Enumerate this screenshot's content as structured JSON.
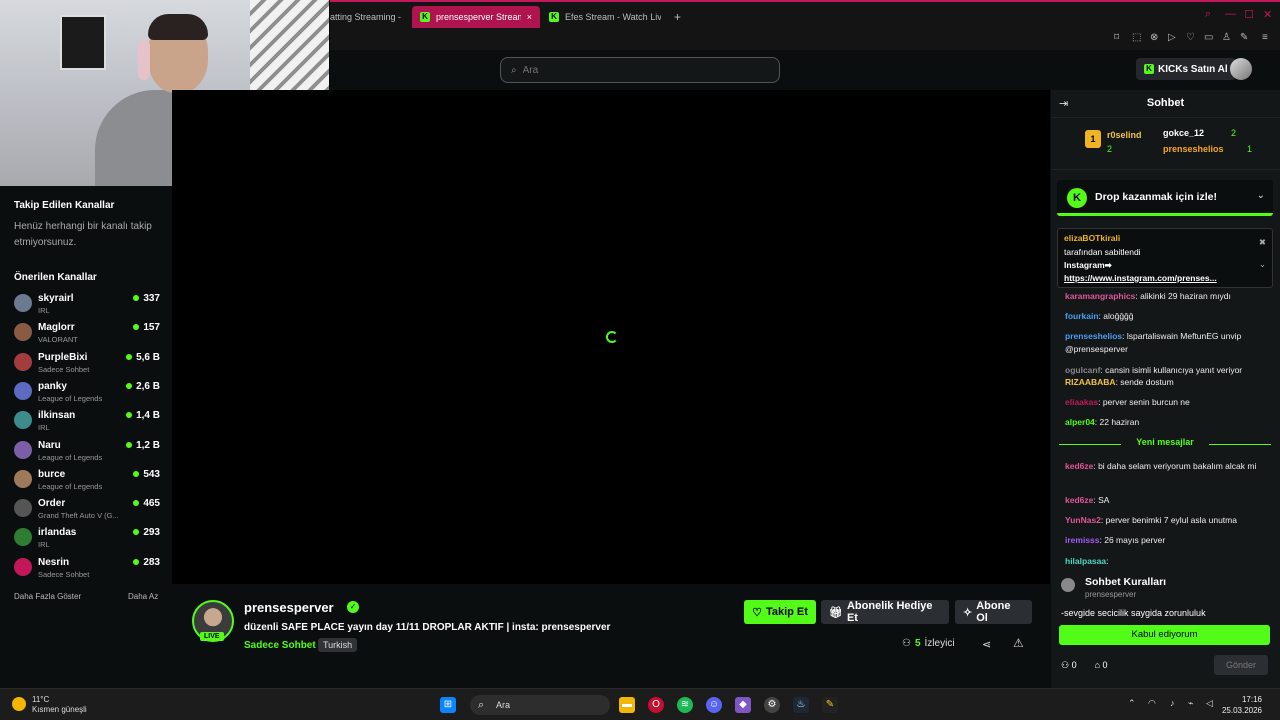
{
  "browser": {
    "tabs": [
      {
        "label": "atting Streaming -",
        "active": false
      },
      {
        "label": "prensesperver Stream",
        "active": true
      },
      {
        "label": "Efes Stream - Watch Live",
        "active": false
      }
    ],
    "new_tab": "+",
    "close": "×"
  },
  "header": {
    "search_placeholder": "Ara",
    "kicks_label": "KICKs Satın Al"
  },
  "sidebar": {
    "followed_title": "Takip Edilen Kanallar",
    "followed_empty": "Henüz herhangi bir kanalı takip etmiyorsunuz.",
    "recommended_title": "Önerilen Kanallar",
    "channels": [
      {
        "name": "skyrairl",
        "category": "IRL",
        "viewers": "337",
        "color": "#6b7a8f"
      },
      {
        "name": "Maglorr",
        "category": "VALORANT",
        "viewers": "157",
        "color": "#8a5a44"
      },
      {
        "name": "PurpleBixi",
        "category": "Sadece Sohbet",
        "viewers": "5,6 B",
        "color": "#a33d3d"
      },
      {
        "name": "panky",
        "category": "League of Legends",
        "viewers": "2,6 B",
        "color": "#5c6bc0"
      },
      {
        "name": "ilkinsan",
        "category": "IRL",
        "viewers": "1,4 B",
        "color": "#3d8b8b"
      },
      {
        "name": "Naru",
        "category": "League of Legends",
        "viewers": "1,2 B",
        "color": "#7b5ea7"
      },
      {
        "name": "burce",
        "category": "League of Legends",
        "viewers": "543",
        "color": "#9e7a5a"
      },
      {
        "name": "Order",
        "category": "Grand Theft Auto V (G...",
        "viewers": "465",
        "color": "#555555"
      },
      {
        "name": "irlandas",
        "category": "IRL",
        "viewers": "293",
        "color": "#2e7d32"
      },
      {
        "name": "Nesrin",
        "category": "Sadece Sohbet",
        "viewers": "283",
        "color": "#c2185b"
      }
    ],
    "show_more": "Daha Fazla Göster",
    "show_less": "Daha Az"
  },
  "stream": {
    "name": "prensesperver",
    "live": "LIVE",
    "title": "düzenli SAFE PLACE yayın day 11/11 DROPLAR AKTIF | insta: prensesperver",
    "category": "Sadece Sohbet",
    "language": "Turkish",
    "follow": "Takip Et",
    "gift_sub": "Abonelik Hediye Et",
    "subscribe": "Abone Ol",
    "viewers_count": "5",
    "viewers_label": "İzleyici"
  },
  "chat": {
    "title": "Sohbet",
    "leaderboard": [
      {
        "rank": "1",
        "name": "r0selind",
        "value": "2"
      },
      {
        "name": "gokce_12",
        "value": "2"
      },
      {
        "name": "prenseshelios",
        "value": "1"
      }
    ],
    "drop_text": "Drop kazanmak için izle!",
    "pinned": {
      "user": "elizaBOTkirali",
      "by": "tarafından sabitlendi",
      "title": "Instagram➡",
      "link": "https://www.instagram.com/prenses..."
    },
    "messages": [
      {
        "user": "karamangraphics",
        "text": ": alikinki 29 haziran mıydı",
        "color": "#e0569b"
      },
      {
        "user": "fourkain",
        "text": ": aloğğğğ",
        "color": "#4a9ff5"
      },
      {
        "user": "prenseshelios",
        "text": ": lspartaliswain MeftunEG unvip @prensesperver",
        "color": "#4a9ff5"
      },
      {
        "user": "ogulcanf",
        "text": ": cansin isimli kullanıcıya yanıt veriyor",
        "color": "#888888"
      },
      {
        "user": "RIZAABABA",
        "text": ": sende dostum",
        "color": "#f0c24b"
      },
      {
        "user": "eliaakas",
        "text": ": perver senin burcun ne",
        "color": "#c2185b"
      },
      {
        "user": "alper04",
        "text": ": 22 haziran",
        "color": "#53fc18"
      },
      {
        "user": "ked6ze",
        "text": ": bi daha selam veriyorum bakalım alcak mi",
        "color": "#e0569b"
      },
      {
        "user": "ked6ze",
        "text": ": SA",
        "color": "#e0569b"
      },
      {
        "user": "YunNas2",
        "text": ": perver benimki 7 eylul asla unutma",
        "color": "#e0569b"
      },
      {
        "user": "iremisss",
        "text": ": 26 mayıs perver",
        "color": "#a25cf5"
      },
      {
        "user": "hilalpasaa",
        "text": ":",
        "color": "#4ad6c4"
      }
    ],
    "new_messages": "Yeni mesajlar",
    "rules_title": "Sohbet Kuralları",
    "rules_user": "prensesperver",
    "rules_text": "-sevgide secicilik saygida zorunluluk",
    "accept": "Kabul ediyorum",
    "bottom_left": "0",
    "bottom_right": "0",
    "send": "Gönder"
  },
  "taskbar": {
    "weather_temp": "11°C",
    "weather_desc": "Kısmen güneşli",
    "search": "Ara",
    "time": "17:16",
    "date": "25.03.2026"
  }
}
